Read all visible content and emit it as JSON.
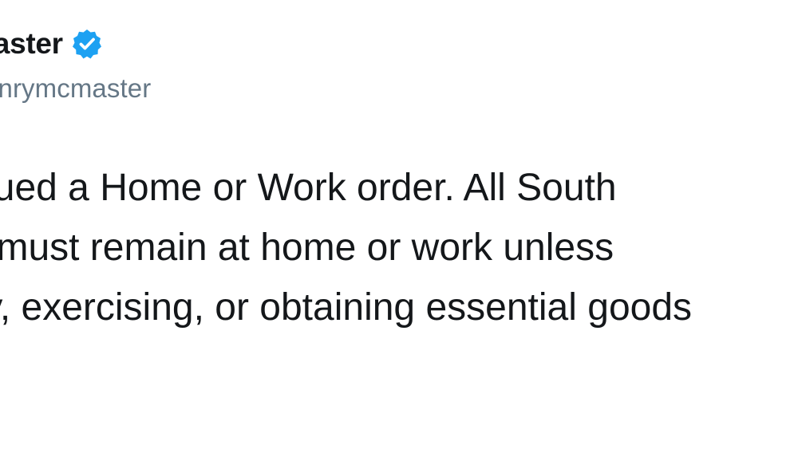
{
  "tweet": {
    "author": {
      "display_name": "Governor Henry McMaster",
      "handle": "@henrymcmaster",
      "verified_icon": "verified-badge-icon",
      "verified_color": "#1da1f2"
    },
    "text_lines": [
      "I have issued a Home or Work order. All South",
      "Carolinians must remain at home or work unless",
      "visiting family, exercising, or obtaining essential goods"
    ]
  },
  "colors": {
    "text_primary": "#14171a",
    "text_secondary": "#657786",
    "background": "#ffffff"
  }
}
